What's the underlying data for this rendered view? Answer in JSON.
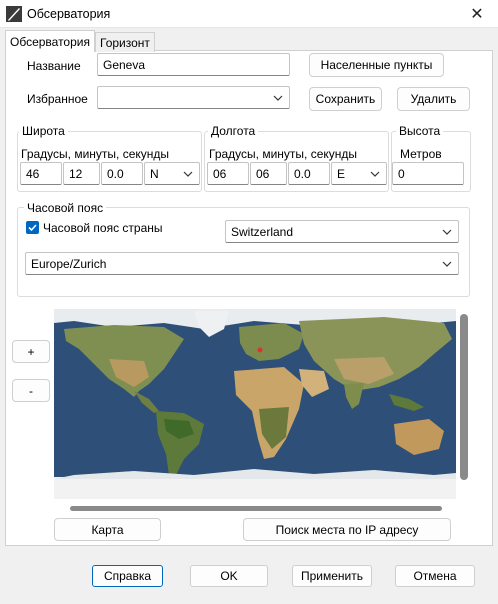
{
  "window": {
    "title": "Обсерватория",
    "close_glyph": "✕"
  },
  "tabs": [
    {
      "label": "Обсерватория",
      "active": true
    },
    {
      "label": "Горизонт",
      "active": false
    }
  ],
  "name": {
    "label": "Название",
    "value": "Geneva"
  },
  "settlements_button": "Населенные пункты",
  "favorites": {
    "label": "Избранное",
    "value": ""
  },
  "save_button": "Сохранить",
  "delete_button": "Удалить",
  "latitude": {
    "title": "Широта",
    "sublabel": "Градусы, минуты, секунды",
    "degrees": "46",
    "minutes": "12",
    "seconds": "0.0",
    "hemisphere": "N"
  },
  "longitude": {
    "title": "Долгота",
    "sublabel": "Градусы, минуты, секунды",
    "degrees": "06",
    "minutes": "06",
    "seconds": "0.0",
    "hemisphere": "E"
  },
  "altitude": {
    "title": "Высота",
    "sublabel": "Метров",
    "value": "0"
  },
  "timezone": {
    "title": "Часовой пояс",
    "country_tz_checkbox_label": "Часовой пояс страны",
    "country_tz_checked": true,
    "country": "Switzerland",
    "zone": "Europe/Zurich"
  },
  "zoom": {
    "plus": "+",
    "minus": "-"
  },
  "map_button": "Карта",
  "ip_search_button": "Поиск места по IP адресу",
  "footer": {
    "help": "Справка",
    "ok": "OK",
    "apply": "Применить",
    "cancel": "Отмена"
  },
  "colors": {
    "accent": "#0067c0",
    "ocean": "#2d4f78",
    "land": "#7f8f52",
    "desert": "#c9a56a",
    "ice": "#f2f2f2"
  },
  "icons": {
    "app": "telescope-icon",
    "close": "close-icon",
    "dropdown": "chevron-down-icon",
    "check": "checkmark-icon",
    "marker": "location-marker-icon"
  }
}
